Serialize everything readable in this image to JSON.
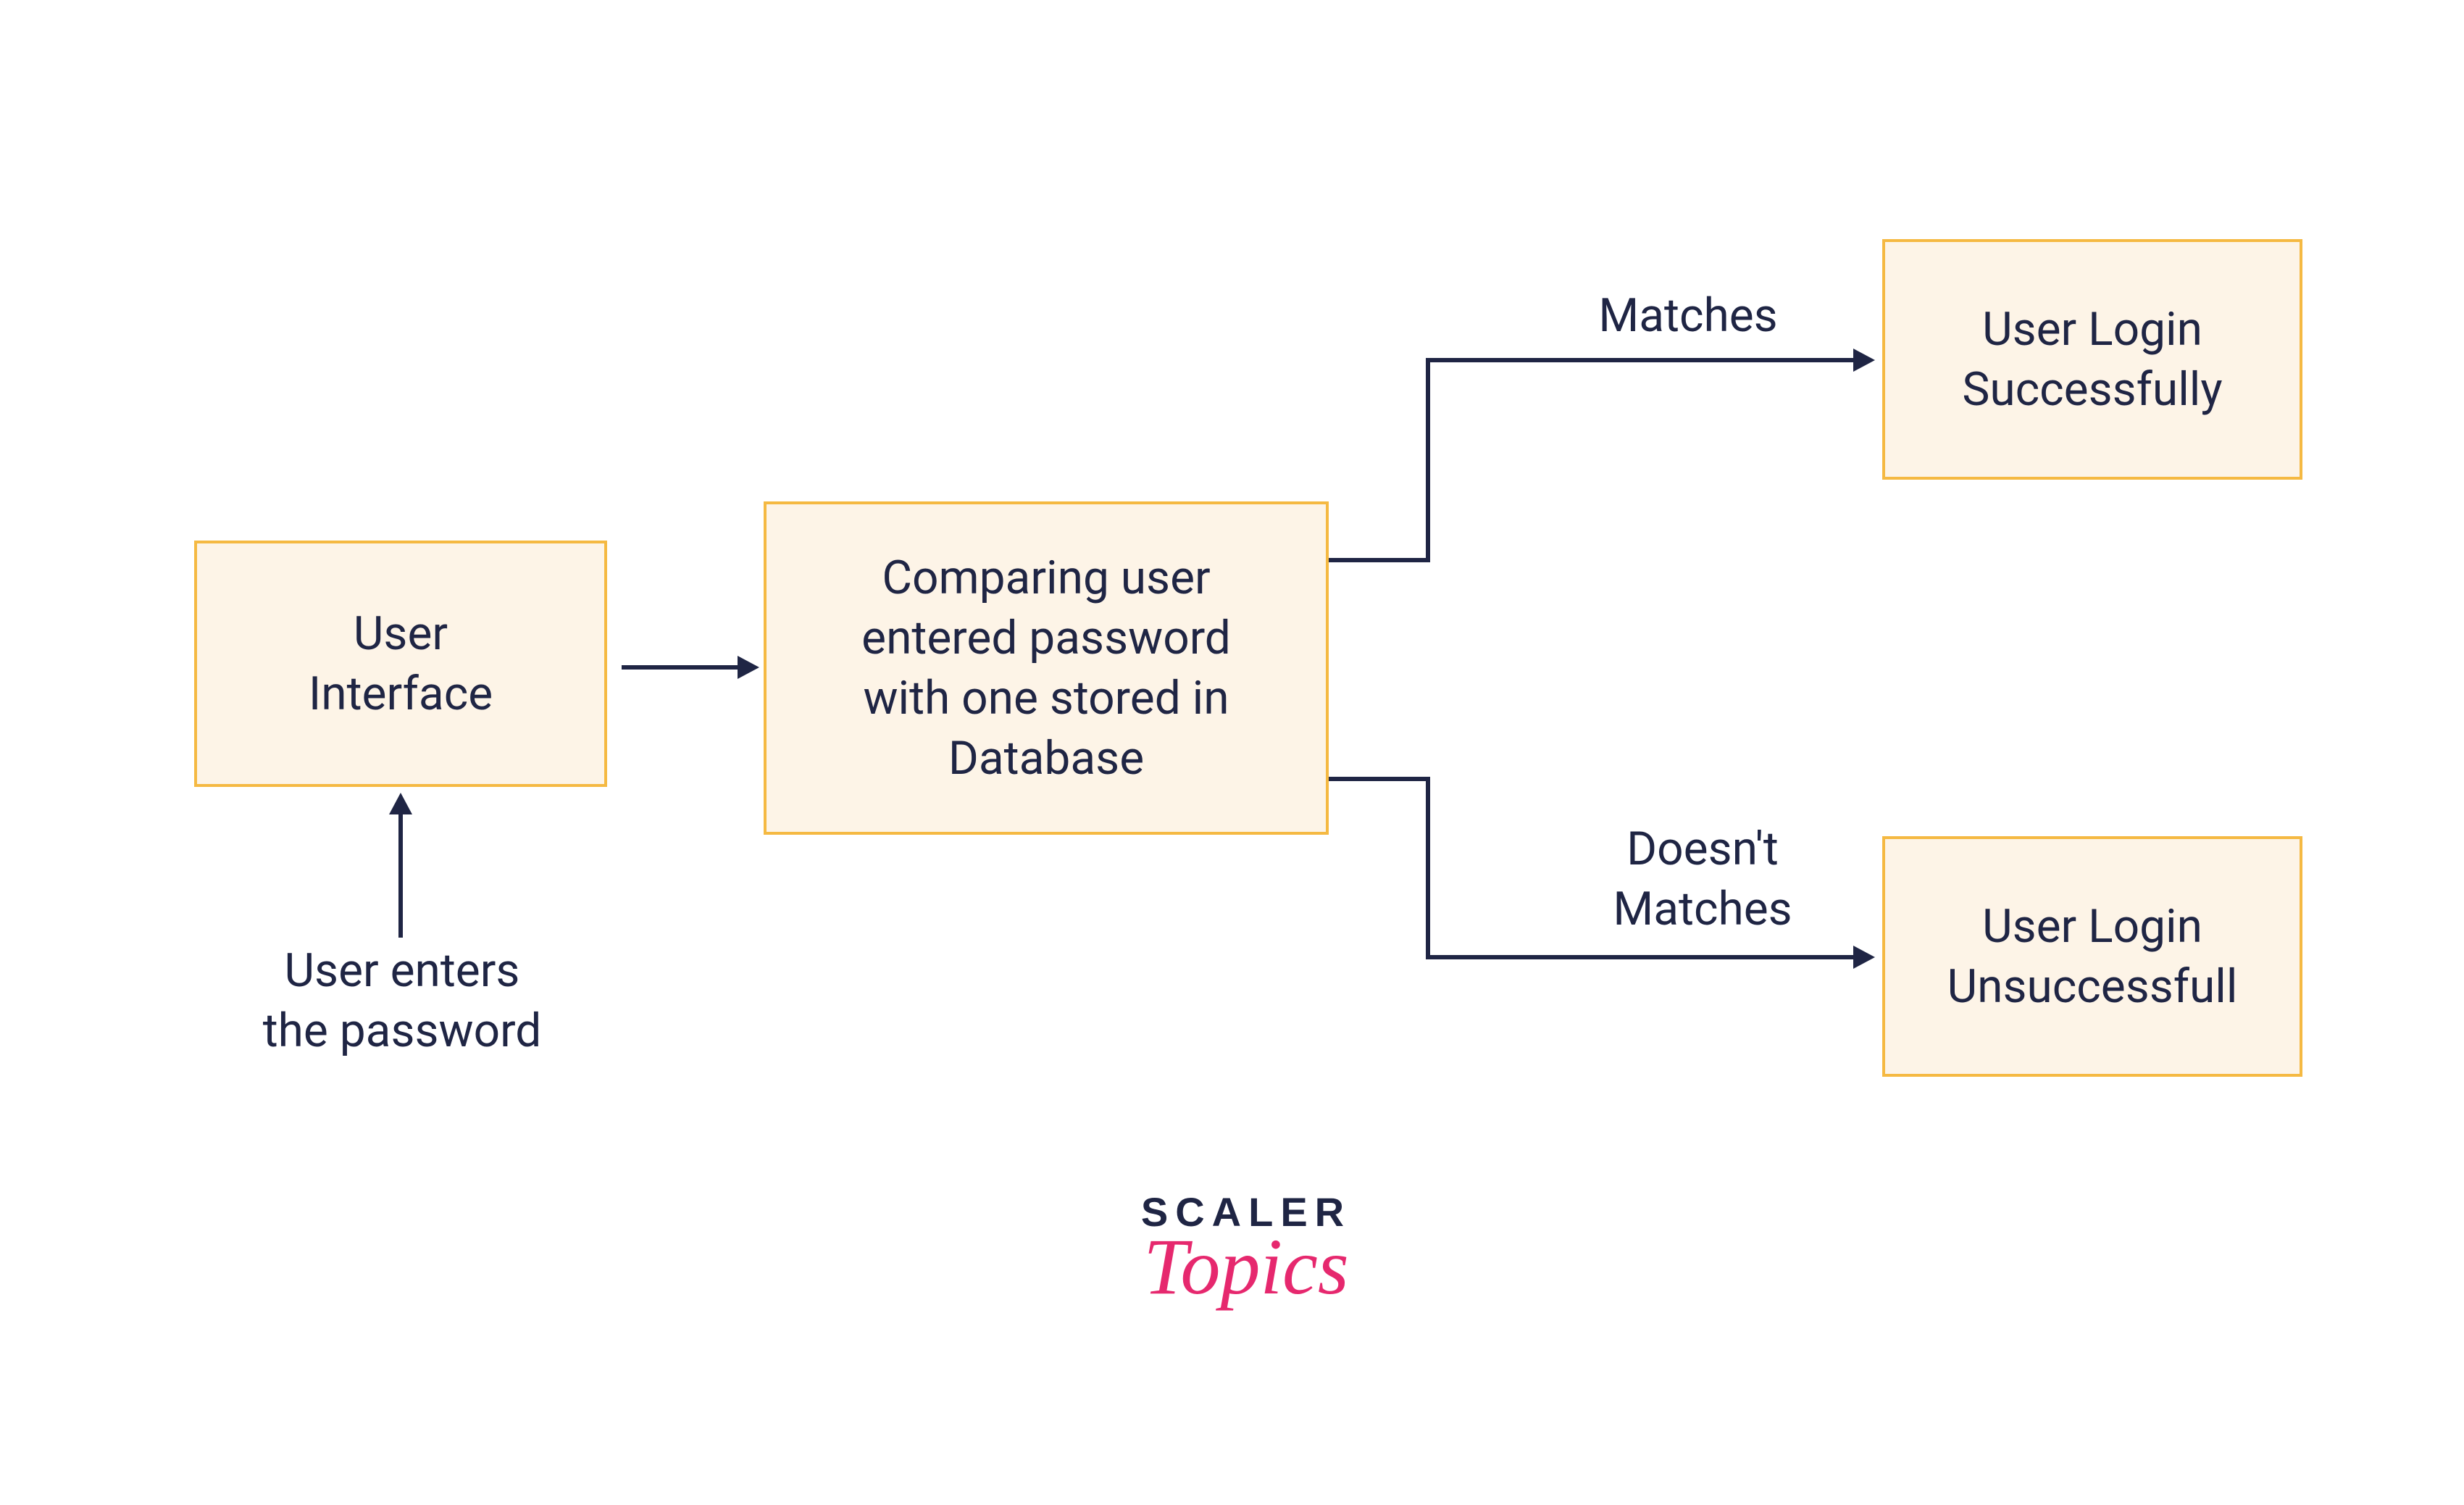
{
  "nodes": {
    "user_interface": "User\nInterface",
    "compare": "Comparing user\nentered password\nwith one stored in\nDatabase",
    "login_success": "User Login\nSuccessfully",
    "login_fail": "User Login\nUnsuccessfull"
  },
  "labels": {
    "enters_password": "User enters\nthe password",
    "matches": "Matches",
    "doesnt_match": "Doesn't\nMatches"
  },
  "logo": {
    "line1": "SCALER",
    "line2": "Topics"
  }
}
